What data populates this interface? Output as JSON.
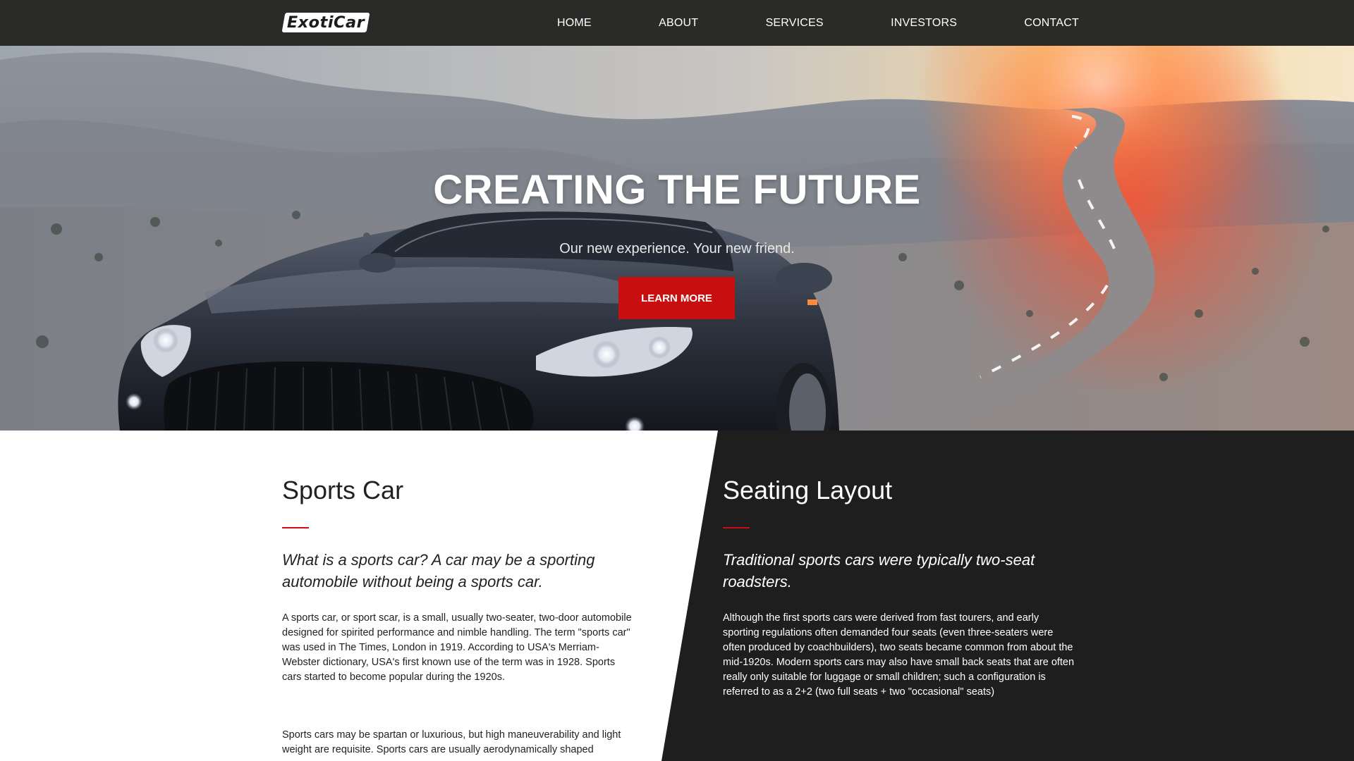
{
  "nav": {
    "logo": "ExotiCar",
    "items": [
      "HOME",
      "ABOUT",
      "SERVICES",
      "INVESTORS",
      "CONTACT"
    ]
  },
  "hero": {
    "title": "CREATING THE FUTURE",
    "subtitle": "Our new experience. Your new friend.",
    "button_label": "LEARN MORE"
  },
  "left": {
    "heading": "Sports Car",
    "lead": "What is a sports car? A car may be a sporting automobile without being a sports car.",
    "p1": "A sports car, or sport scar, is a small, usually two-seater, two-door automobile designed for spirited performance and nimble handling. The term \"sports car\" was used in The Times, London in 1919. According to USA's Merriam-Webster dictionary, USA's first known use of the term was in 1928. Sports cars started to become popular during the 1920s.",
    "p2": "Sports cars may be spartan or luxurious, but high maneuverability and light weight are requisite. Sports cars are usually aerodynamically shaped"
  },
  "right": {
    "heading": "Seating Layout",
    "lead": "Traditional sports cars were typically two-seat roadsters.",
    "p1": "Although the first sports cars were derived from fast tourers, and early sporting regulations often demanded four seats (even three-seaters were often produced by coachbuilders), two seats became common from about the mid-1920s. Modern sports cars may also have small back seats that are often really only suitable for luggage or small children; such a configuration is referred to as a 2+2 (two full seats + two \"occasional\" seats)",
    "p2": ""
  },
  "colors": {
    "nav_bg": "#2a2a28",
    "accent": "#c80f10",
    "dark_panel": "#1e1e1e"
  }
}
